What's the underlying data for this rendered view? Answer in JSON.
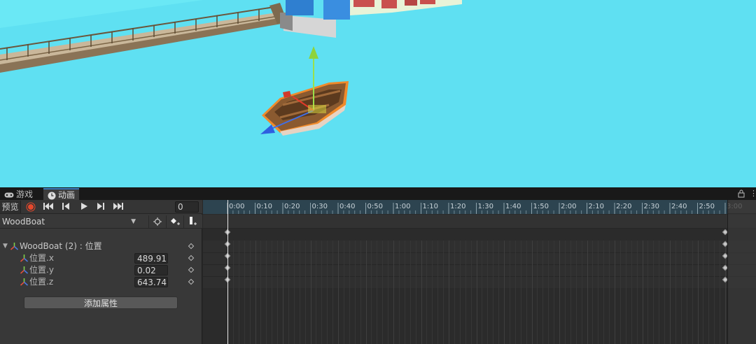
{
  "tabs": [
    {
      "label": "游戏",
      "icon": "gamepad-icon"
    },
    {
      "label": "动画",
      "icon": "clock-icon"
    }
  ],
  "toolbar": {
    "preview_label": "预览",
    "frame_value": "0"
  },
  "clip": {
    "name": "WoodBoat"
  },
  "properties": {
    "group_label": "WoodBoat (2) : 位置",
    "items": [
      {
        "label": "位置.x",
        "value": "489.91"
      },
      {
        "label": "位置.y",
        "value": "0.02"
      },
      {
        "label": "位置.z",
        "value": "643.74"
      }
    ],
    "add_button_label": "添加属性"
  },
  "timeline": {
    "tick_labels": [
      "0:00",
      "0:10",
      "0:20",
      "0:30",
      "0:40",
      "0:50",
      "1:00",
      "1:10",
      "1:20",
      "1:30",
      "1:40",
      "1:50",
      "2:00",
      "2:10",
      "2:20",
      "2:30",
      "2:40",
      "2:50",
      "3:00"
    ],
    "keyframes_at": [
      "0:00",
      "3:00"
    ]
  },
  "colors": {
    "water": "#5fe0f2",
    "record": "#e5482c",
    "accent": "#3a79bb"
  }
}
